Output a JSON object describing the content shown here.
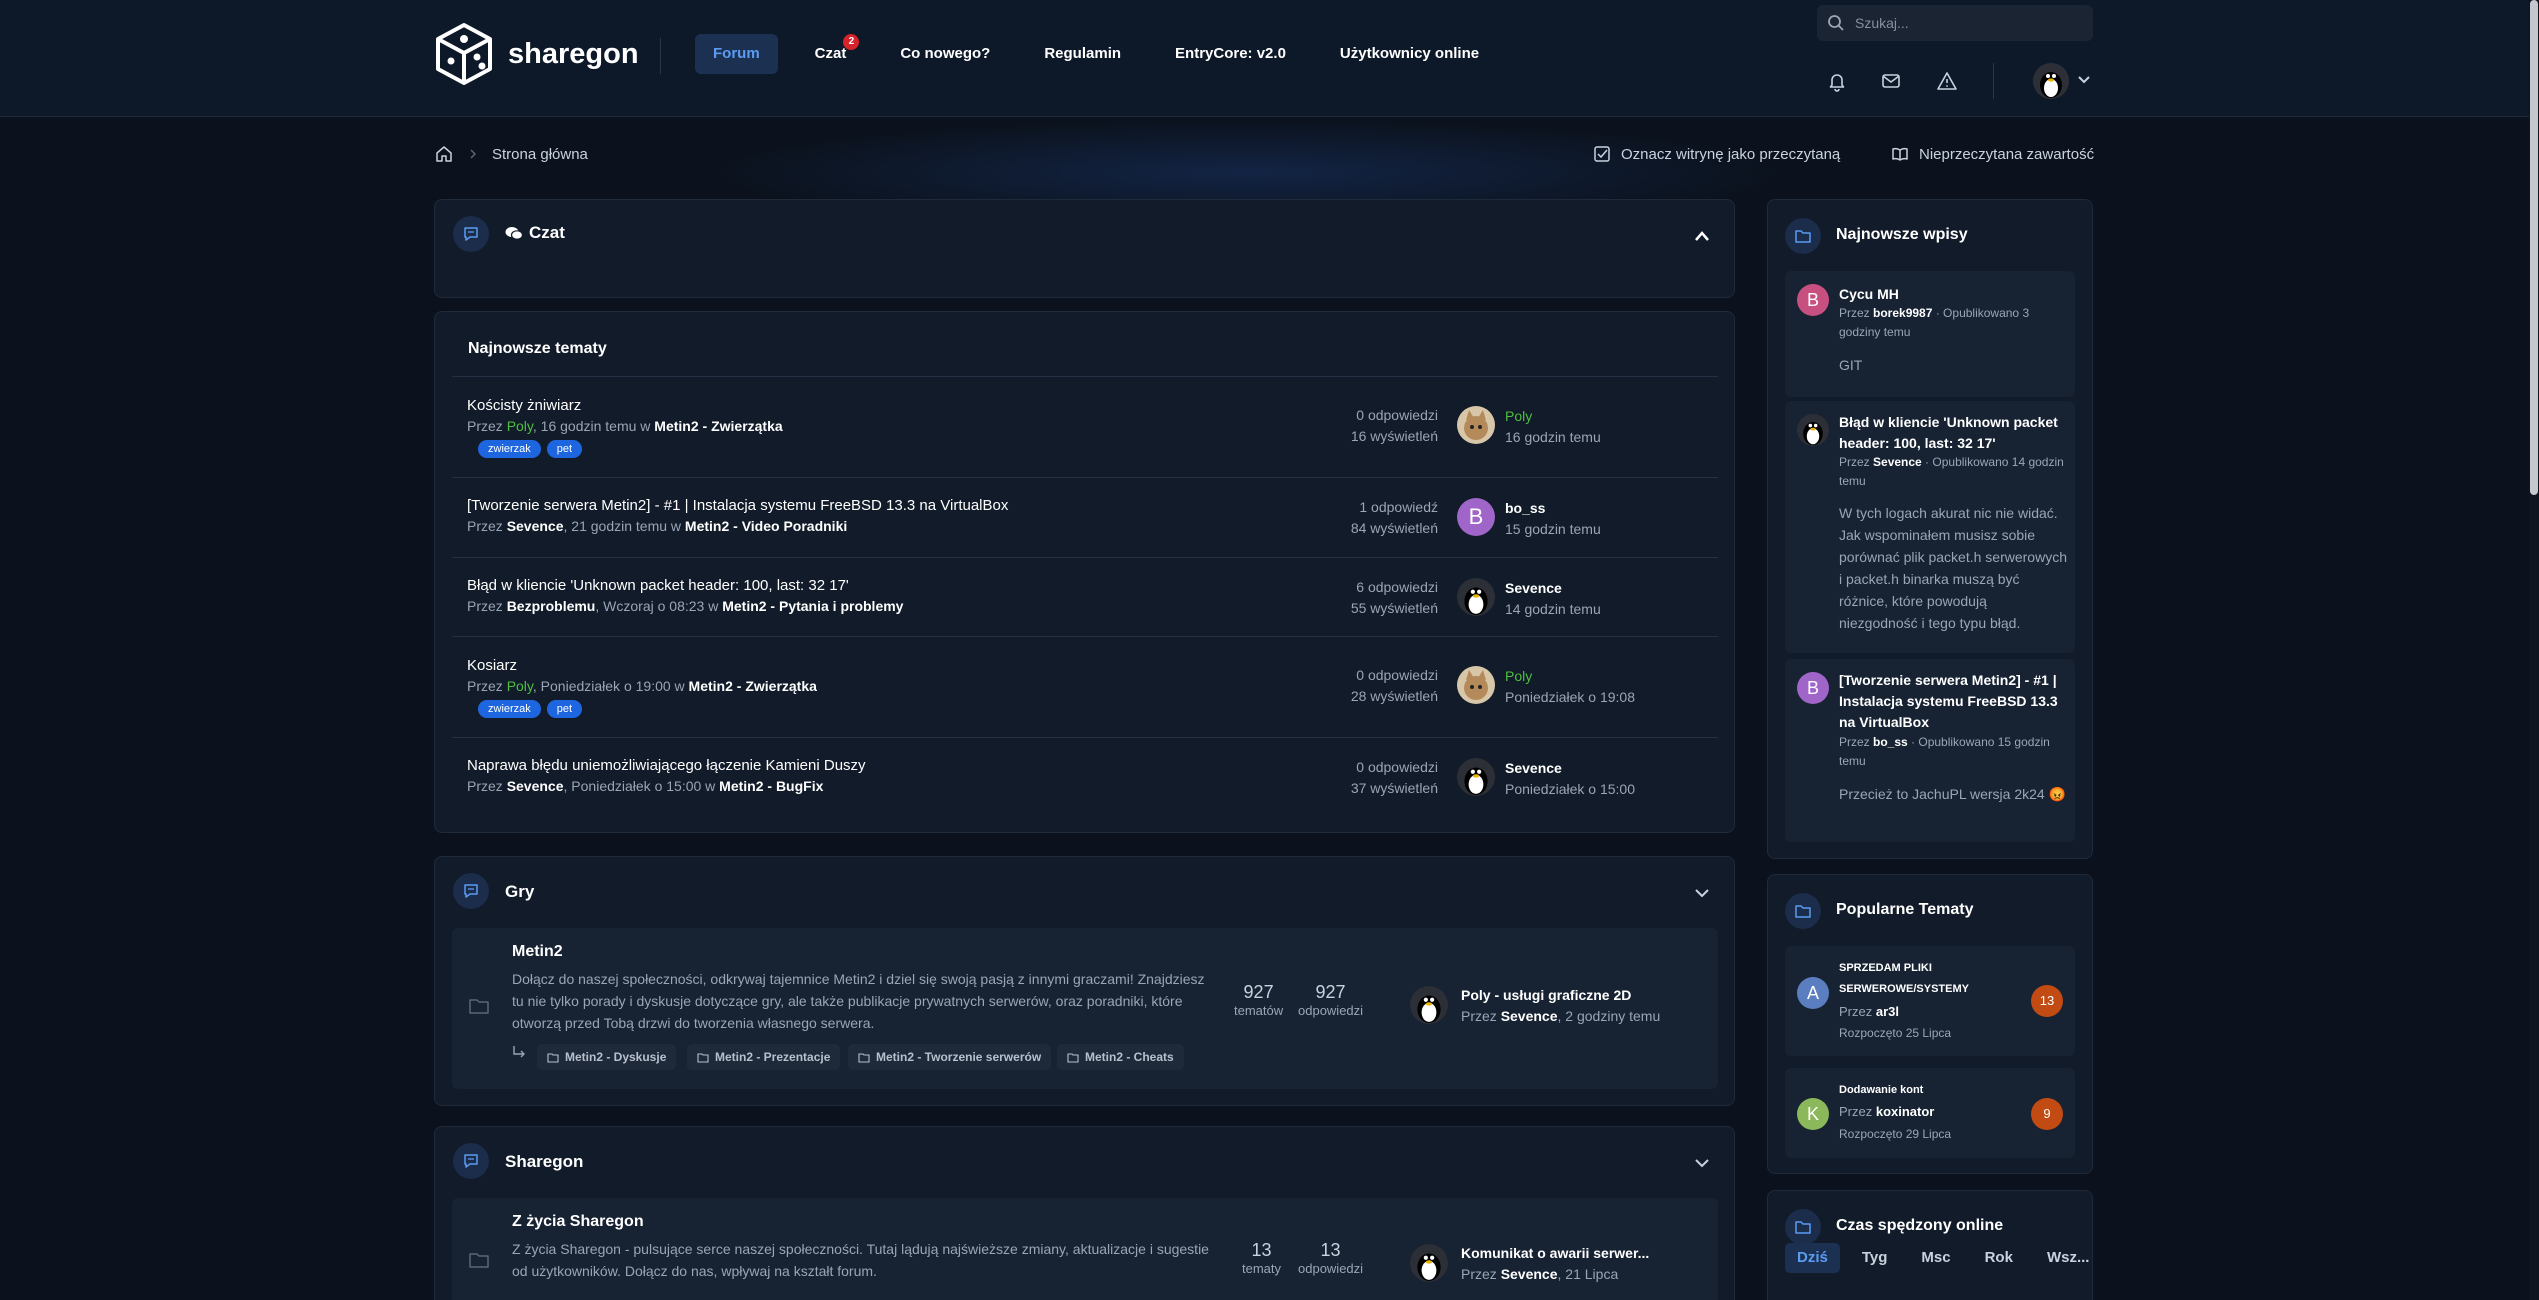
{
  "header": {
    "logo_text": "sharegon",
    "nav": [
      {
        "label": "Forum",
        "active": true
      },
      {
        "label": "Czat",
        "badge": "2"
      },
      {
        "label": "Co nowego?"
      },
      {
        "label": "Regulamin"
      },
      {
        "label": "EntryCore: v2.0"
      },
      {
        "label": "Użytkownicy online"
      }
    ],
    "search_placeholder": "Szukaj..."
  },
  "breadcrumb": {
    "home_icon": "home-icon",
    "current": "Strona główna"
  },
  "actions": {
    "mark_read": "Oznacz witrynę jako przeczytaną",
    "unread": "Nieprzeczytana zawartość"
  },
  "chat": {
    "title": "Czat"
  },
  "latest_topics": {
    "title": "Najnowsze tematy",
    "rows": [
      {
        "title": "Kościsty żniwiarz",
        "by_prefix": "Przez ",
        "author": "Poly",
        "author_green": true,
        "when": ", 16 godzin temu w ",
        "forum": "Metin2 - Zwierzątka",
        "tags": [
          "zwierzak",
          "pet"
        ],
        "replies": "0 odpowiedzi",
        "views": "16 wyświetleń",
        "last_user": "Poly",
        "last_green": true,
        "last_time": "16 godzin temu",
        "avatar": "cat"
      },
      {
        "title": "[Tworzenie serwera Metin2] - #1 | Instalacja systemu FreeBSD 13.3 na VirtualBox",
        "by_prefix": "Przez ",
        "author": "Sevence",
        "when": ", 21 godzin temu w ",
        "forum": "Metin2 - Video Poradniki",
        "tags": [],
        "replies": "1 odpowiedź",
        "views": "84 wyświetleń",
        "last_user": "bo_ss",
        "last_time": "15 godzin temu",
        "avatar": "B"
      },
      {
        "title": "Błąd w kliencie 'Unknown packet header: 100, last: 32 17'",
        "by_prefix": "Przez ",
        "author": "Bezproblemu",
        "when": ", Wczoraj o 08:23 w ",
        "forum": "Metin2 - Pytania i problemy",
        "tags": [],
        "replies": "6 odpowiedzi",
        "views": "55 wyświetleń",
        "last_user": "Sevence",
        "last_time": "14 godzin temu",
        "avatar": "tux"
      },
      {
        "title": "Kosiarz",
        "by_prefix": "Przez ",
        "author": "Poly",
        "author_green": true,
        "when": ", Poniedziałek o 19:00 w ",
        "forum": "Metin2 - Zwierzątka",
        "tags": [
          "zwierzak",
          "pet"
        ],
        "replies": "0 odpowiedzi",
        "views": "28 wyświetleń",
        "last_user": "Poly",
        "last_green": true,
        "last_time": "Poniedziałek o 19:08",
        "avatar": "cat"
      },
      {
        "title": "Naprawa błędu uniemożliwiającego łączenie Kamieni Duszy",
        "by_prefix": "Przez ",
        "author": "Sevence",
        "when": ", Poniedziałek o 15:00 w ",
        "forum": "Metin2 - BugFix",
        "tags": [],
        "replies": "0 odpowiedzi",
        "views": "37 wyświetleń",
        "last_user": "Sevence",
        "last_time": "Poniedziałek o 15:00",
        "avatar": "tux"
      }
    ]
  },
  "gry": {
    "title": "Gry",
    "forum": {
      "name": "Metin2",
      "desc": "Dołącz do naszej społeczności, odkrywaj tajemnice Metin2 i dziel się swoją pasją z innymi graczami! Znajdziesz tu nie tylko porady i dyskusje dotyczące gry, ale także publikacje prywatnych serwerów, oraz poradniki, które otworzą przed Tobą drzwi do tworzenia własnego serwera.",
      "topics_n": "927",
      "topics_label": "tematów",
      "replies_n": "927",
      "replies_label": "odpowiedzi",
      "last_title": "Poly - usługi graficzne 2D",
      "last_prefix": "Przez ",
      "last_user": "Sevence",
      "last_time": ", 2 godziny temu",
      "subforums": [
        "Metin2 - Dyskusje",
        "Metin2 - Prezentacje",
        "Metin2 - Tworzenie serwerów",
        "Metin2 - Cheats"
      ]
    }
  },
  "sharegon": {
    "title": "Sharegon",
    "forum": {
      "name": "Z życia Sharegon",
      "desc": "Z życia Sharegon - pulsujące serce naszej społeczności. Tutaj lądują najświeższe zmiany, aktualizacje i sugestie od użytkowników. Dołącz do nas, wpływaj na kształt forum.",
      "topics_n": "13",
      "topics_label": "tematy",
      "replies_n": "13",
      "replies_label": "odpowiedzi",
      "last_title": "Komunikat o awarii serwer...",
      "last_prefix": "Przez ",
      "last_user": "Sevence",
      "last_time": ", 21 Lipca"
    }
  },
  "sidebar": {
    "latest_posts": {
      "title": "Najnowsze wpisy",
      "items": [
        {
          "title": "Cycu MH",
          "by": "Przez ",
          "user": "borek9987",
          "meta_rest": " · Opublikowano 3 godziny temu",
          "text": "GIT",
          "avatar": "B"
        },
        {
          "title": "Błąd w kliencie 'Unknown packet header: 100, last: 32 17'",
          "by": "Przez ",
          "user": "Sevence",
          "meta_rest": " · Opublikowano 14 godzin temu",
          "text": "W tych logach akurat nic nie widać. Jak wspominałem musisz sobie porównać plik packet.h serwerowych i packet.h binarka muszą być różnice, które powodują niezgodność i tego typu błąd.",
          "avatar": "tux"
        },
        {
          "title": "[Tworzenie serwera Metin2] - #1 | Instalacja systemu FreeBSD 13.3 na VirtualBox",
          "by": "Przez ",
          "user": "bo_ss",
          "meta_rest": " · Opublikowano 15 godzin temu",
          "text": "Przecież to JachuPL wersja 2k24 😡",
          "avatar": "B"
        }
      ]
    },
    "popular": {
      "title": "Popularne Tematy",
      "items": [
        {
          "title": "SPRZEDAM PLIKI SERWEROWE/SYSTEMY",
          "by": "Przez ",
          "user": "ar3l",
          "started": "Rozpoczęto 25 Lipca",
          "count": "13",
          "avatar": "A"
        },
        {
          "title": "Dodawanie kont",
          "by": "Przez ",
          "user": "koxinator",
          "started": "Rozpoczęto 29 Lipca",
          "count": "9",
          "avatar": "K"
        }
      ]
    },
    "online_time": {
      "title": "Czas spędzony online",
      "tabs": [
        "Dziś",
        "Tyg",
        "Msc",
        "Rok",
        "Wsz..."
      ]
    }
  },
  "colors": {
    "accent": "#5b9cf2",
    "green": "#4fbf3f",
    "tag": "#1e66e0",
    "badge": "#d6222b",
    "count": "#c24b13"
  }
}
